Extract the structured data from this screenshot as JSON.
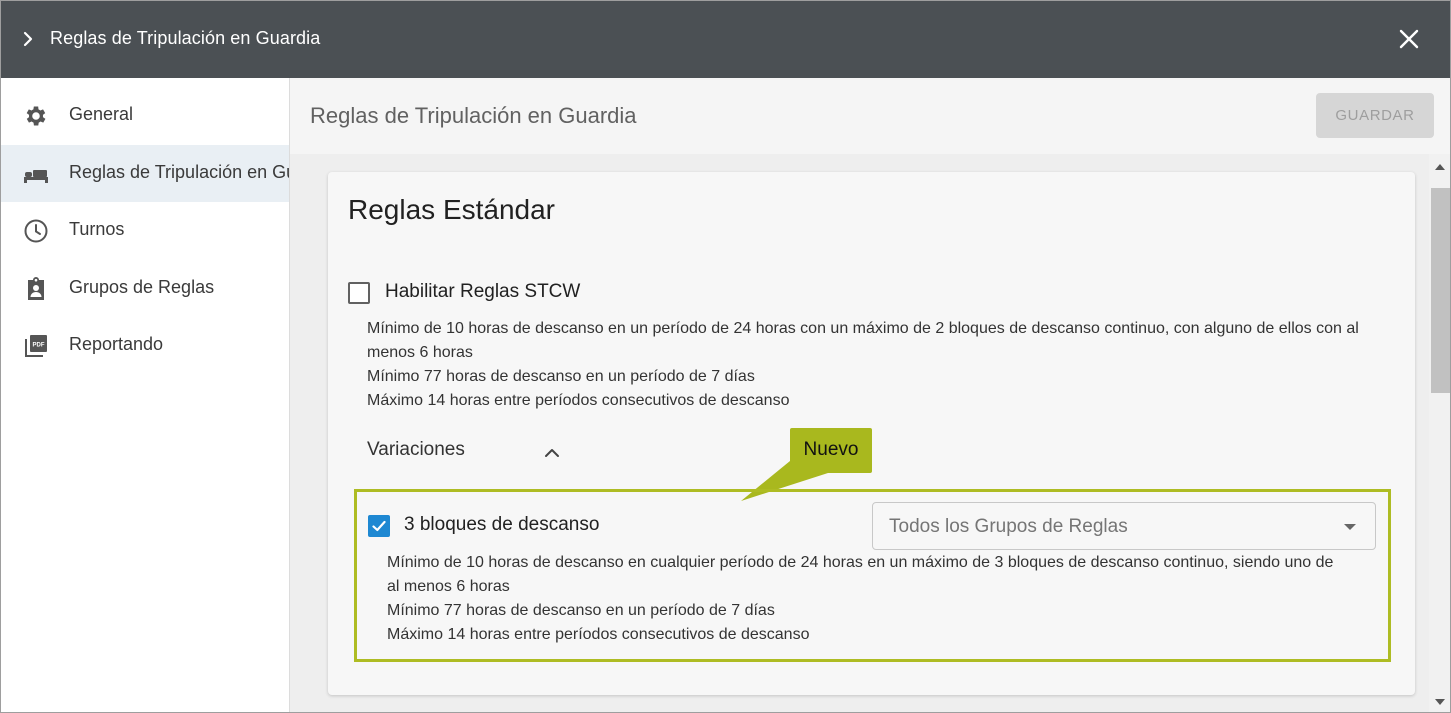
{
  "window": {
    "title": "Reglas de Tripulación en Guardia",
    "expand_icon": "chevron-right-icon",
    "close_icon": "close-icon"
  },
  "sidebar": {
    "items": [
      {
        "label": "General",
        "icon": "gear-icon"
      },
      {
        "label": "Reglas de Tripulación en Guardia",
        "icon": "bed-icon",
        "active": true
      },
      {
        "label": "Turnos",
        "icon": "clock-icon"
      },
      {
        "label": "Grupos de Reglas",
        "icon": "clipboard-user-icon"
      },
      {
        "label": "Reportando",
        "icon": "pdf-icon"
      }
    ]
  },
  "main": {
    "title": "Reglas de Tripulación en Guardia",
    "save_label": "GUARDAR",
    "card": {
      "title": "Reglas Estándar",
      "stcw": {
        "label": "Habilitar Reglas STCW",
        "checked": false,
        "lines": [
          "Mínimo de 10 horas de descanso en un período de 24 horas con un máximo de 2 bloques de descanso continuo, con alguno de ellos con al",
          "menos 6 horas",
          "Mínimo 77 horas de descanso en un período de 7 días",
          "Máximo 14 horas entre períodos consecutivos de descanso"
        ]
      },
      "variations": {
        "label": "Variaciones",
        "expanded": true
      },
      "badge": "Nuevo",
      "variation": {
        "label": "3 bloques de descanso",
        "checked": true,
        "select_value": "Todos los Grupos de Reglas",
        "lines": [
          "Mínimo de 10 horas de descanso en cualquier período de 24 horas en un máximo de 3 bloques de descanso continuo, siendo uno de",
          "al menos 6 horas",
          "Mínimo 77 horas de descanso en un período de 7 días",
          "Máximo 14 horas entre períodos consecutivos de descanso"
        ]
      }
    }
  },
  "colors": {
    "titlebar": "#4b5054",
    "accent_checkbox": "#1e88d2",
    "highlight": "#aebc23",
    "badge": "#a9b81e",
    "active_nav": "#e9eff4"
  }
}
